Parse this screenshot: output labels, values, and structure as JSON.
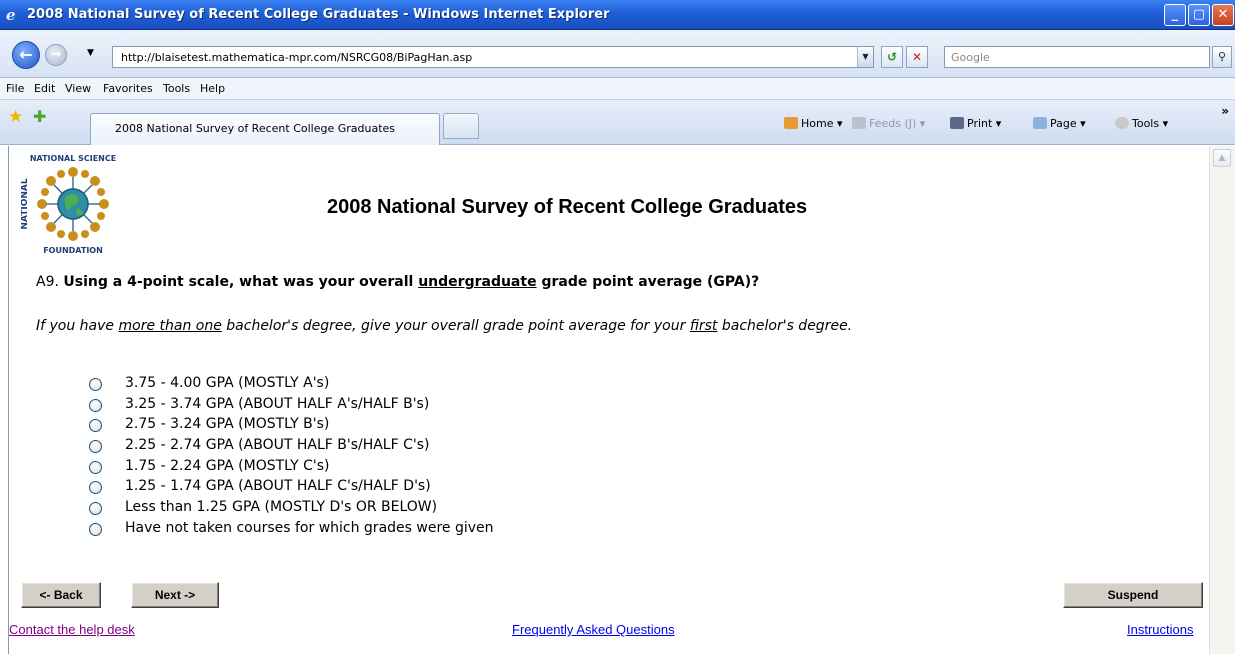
{
  "window": {
    "title": "2008 National Survey of Recent College Graduates - Windows Internet Explorer",
    "controls": [
      "_",
      "▢",
      "✕"
    ]
  },
  "address_bar": {
    "url": "http://blaisetest.mathematica-mpr.com/NSRCG08/BiPagHan.asp",
    "search_placeholder": "Google"
  },
  "menu": [
    "File",
    "Edit",
    "View",
    "Favorites",
    "Tools",
    "Help"
  ],
  "tab": {
    "label": "2008 National Survey of Recent College Graduates"
  },
  "command_bar": {
    "home": "Home",
    "feeds": "Feeds (J)",
    "print": "Print",
    "page": "Page",
    "tools": "Tools"
  },
  "page": {
    "logo_text_top": "NATIONAL SCIENCE",
    "logo_text_bottom": "FOUNDATION",
    "title": "2008 National Survey of Recent College Graduates",
    "question_number": "A9.",
    "question_part1": "Using a 4-point scale, what was your overall ",
    "question_underlined": "undergraduate",
    "question_part2": " grade point average (GPA)?",
    "instruction": {
      "part1": "If you have ",
      "underlined1": "more than one",
      "part2": " bachelor's degree, give your overall grade point average for your ",
      "underlined2": "first",
      "part3": " bachelor's degree."
    },
    "options": [
      "3.75 - 4.00 GPA (MOSTLY A's)",
      "3.25 - 3.74 GPA (ABOUT HALF A's/HALF B's)",
      "2.75 - 3.24 GPA (MOSTLY B's)",
      "2.25 - 2.74 GPA (ABOUT HALF B's/HALF C's)",
      "1.75 - 2.24 GPA (MOSTLY C's)",
      "1.25 - 1.74 GPA (ABOUT HALF C's/HALF D's)",
      "Less than 1.25 GPA (MOSTLY D's OR BELOW)",
      "Have not taken courses for which grades were given"
    ],
    "buttons": {
      "back": "<- Back",
      "next": "Next ->",
      "suspend": "Suspend"
    },
    "links": {
      "help_desk": "Contact the help desk",
      "faq": "Frequently Asked Questions",
      "instructions": "Instructions"
    }
  }
}
